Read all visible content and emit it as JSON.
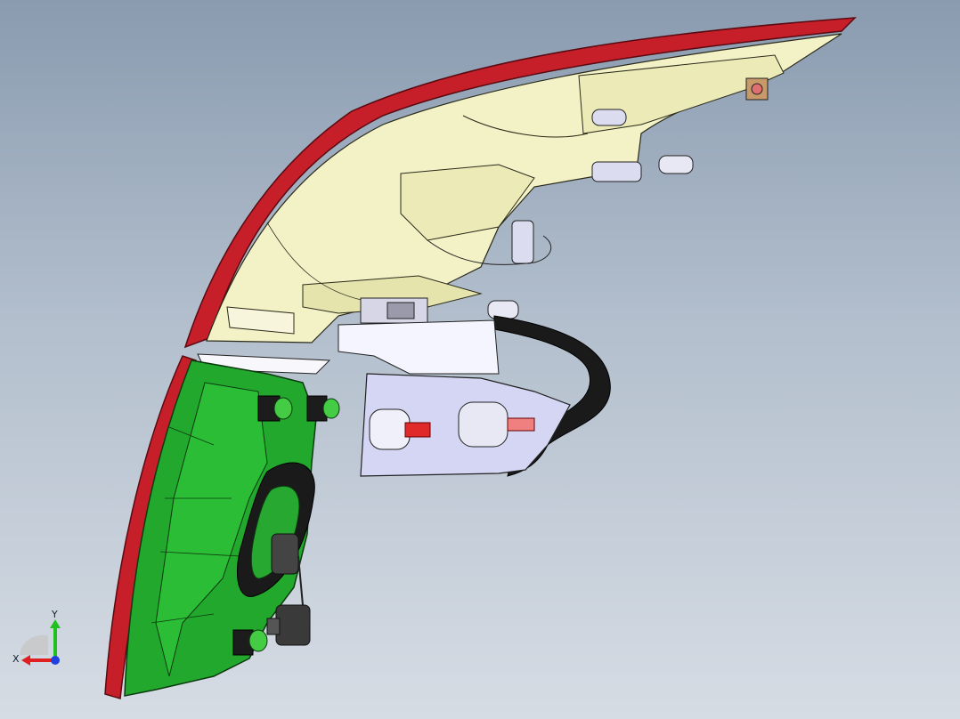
{
  "viewport": {
    "view_name": "cad-3d-viewport"
  },
  "model": {
    "parts": [
      {
        "name": "outer-lens",
        "color": "#c8202a"
      },
      {
        "name": "upper-housing",
        "color": "#f2f0c4"
      },
      {
        "name": "lower-housing",
        "color": "#1fa82a"
      },
      {
        "name": "mounting-bracket",
        "color": "#d4d6f2"
      },
      {
        "name": "gasket",
        "color": "#1a1a1a"
      },
      {
        "name": "connector",
        "color": "#444444"
      }
    ]
  },
  "triad": {
    "x_label": "X",
    "y_label": "Y",
    "x_color": "#e02020",
    "y_color": "#20c020",
    "z_color": "#2040e0"
  }
}
